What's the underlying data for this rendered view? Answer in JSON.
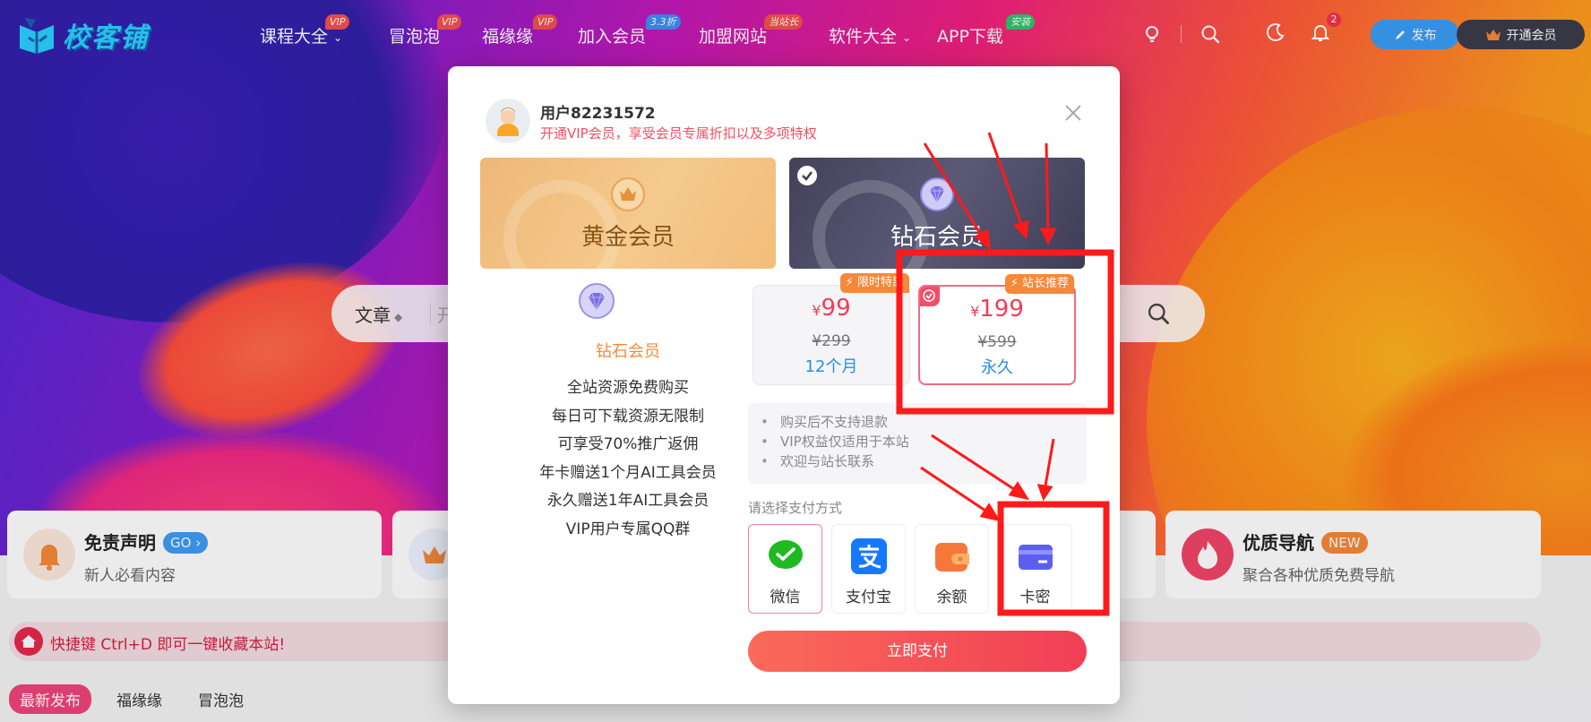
{
  "colors": {
    "accent_red": "#f03e56",
    "annotation_red": "#ff1a1a",
    "publish_blue": "#3b9df5",
    "vip_dark": "#3b3b4a",
    "gold": "#f5ca8d",
    "diamond": "#4f4d6a",
    "price_blue": "#2a8ee0"
  },
  "header": {
    "logo_text": "校客铺",
    "nav": [
      {
        "label": "课程大全",
        "badge": "VIP",
        "badge_color": "#f5504e",
        "has_dropdown": true
      },
      {
        "label": "冒泡泡",
        "badge": "VIP",
        "badge_color": "#f5504e",
        "has_dropdown": false
      },
      {
        "label": "福缘缘",
        "badge": "VIP",
        "badge_color": "#f5504e",
        "has_dropdown": false
      },
      {
        "label": "加入会员",
        "badge": "3.3折",
        "badge_color": "#3f8ef5",
        "has_dropdown": false
      },
      {
        "label": "加盟网站",
        "badge": "当站长",
        "badge_color": "#f5504e",
        "has_dropdown": false
      },
      {
        "label": "软件大全",
        "badge": "",
        "badge_color": "",
        "has_dropdown": true
      },
      {
        "label": "APP下载",
        "badge": "安装",
        "badge_color": "#2bc76b",
        "has_dropdown": false
      }
    ],
    "icons": [
      "lightbulb-icon",
      "search-icon",
      "moon-icon",
      "bell-icon"
    ],
    "notification_count": "2",
    "publish_label": "发布",
    "vip_label": "开通会员"
  },
  "search": {
    "type_label": "文章",
    "placeholder": "开"
  },
  "cards": [
    {
      "title": "免责声明",
      "tag": "GO",
      "tag_color": "#3f9cf5",
      "subtitle": "新人必看内容",
      "icon": "bell-icon"
    },
    {
      "title": "",
      "tag": "",
      "tag_color": "",
      "subtitle": "",
      "icon": "crown-icon"
    },
    {
      "title": "优质导航",
      "tag": "NEW",
      "tag_color": "#f6883a",
      "subtitle": "聚合各种优质免费导航",
      "icon": "fire-icon"
    }
  ],
  "notice": {
    "text": "快捷键 Ctrl+D 即可一键收藏本站!"
  },
  "tabs": [
    {
      "label": "最新发布",
      "active": true
    },
    {
      "label": "福缘缘",
      "active": false
    },
    {
      "label": "冒泡泡",
      "active": false
    }
  ],
  "modal": {
    "username": "用户82231572",
    "subtitle": "开通VIP会员，享受会员专属折扣以及多项特权",
    "plans": [
      {
        "label": "黄金会员",
        "selected": false
      },
      {
        "label": "钻石会员",
        "selected": true
      }
    ],
    "perks_title": "钻石会员",
    "perks": [
      "全站资源免费购买",
      "每日可下载资源无限制",
      "可享受70%推广返佣",
      "年卡赠送1个月AI工具会员",
      "永久赠送1年AI工具会员",
      "VIP用户专属QQ群"
    ],
    "prices": [
      {
        "currency": "¥",
        "price": "99",
        "original": "¥299",
        "duration": "12个月",
        "tag": "限时特惠",
        "selected": false
      },
      {
        "currency": "¥",
        "price": "199",
        "original": "¥599",
        "duration": "永久",
        "tag": "站长推荐",
        "selected": true
      }
    ],
    "notes": [
      "购买后不支持退款",
      "VIP权益仅适用于本站",
      "欢迎与站长联系"
    ],
    "pay_label": "请选择支付方式",
    "pay_methods": [
      {
        "label": "微信",
        "icon": "wechat-icon",
        "color": "#1fb922",
        "active": true
      },
      {
        "label": "支付宝",
        "icon": "alipay-icon",
        "color": "#1678ff",
        "active": false
      },
      {
        "label": "余额",
        "icon": "wallet-icon",
        "color": "#f5783a",
        "active": false
      },
      {
        "label": "卡密",
        "icon": "card-icon",
        "color": "#5b5ff0",
        "active": false
      }
    ],
    "submit_label": "立即支付"
  }
}
